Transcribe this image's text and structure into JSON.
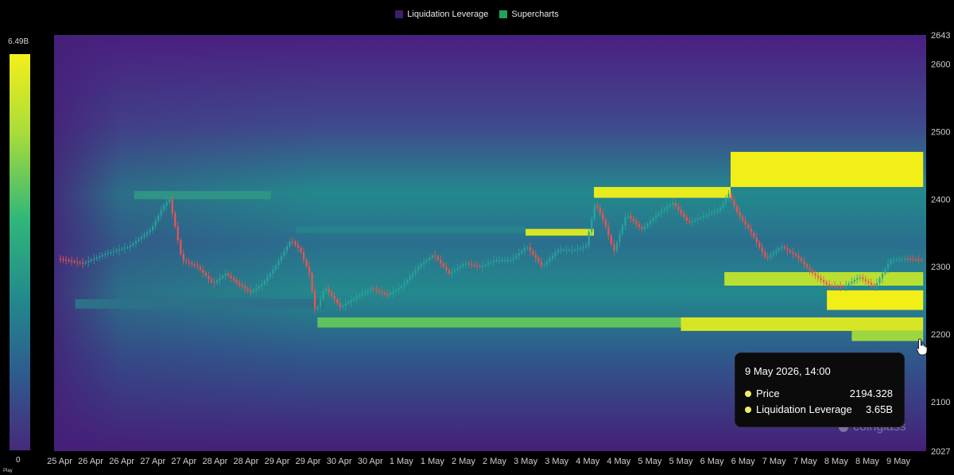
{
  "legend": [
    {
      "label": "Liquidation Leverage",
      "color": "#3f1c6e"
    },
    {
      "label": "Supercharts",
      "color": "#1fa35c"
    }
  ],
  "colorbar": {
    "max_label": "6.49B",
    "min_label": "0"
  },
  "play_label": "Play",
  "tooltip": {
    "title": "9 May 2026, 14:00",
    "rows": [
      {
        "label": "Price",
        "value": "2194.328"
      },
      {
        "label": "Liquidation Leverage",
        "value": "3.65B"
      }
    ]
  },
  "watermark": "coinglass",
  "colors": {
    "background": "#000000",
    "heat_low": "#4a1c7a",
    "heat_mid": "#23898d",
    "heat_high": "#f2ee18",
    "candle_up": "#26a69a",
    "candle_down": "#ef5350"
  },
  "chart_data": {
    "type": "heatmap",
    "title": "",
    "xlabel": "",
    "ylabel": "",
    "x_ticks": [
      "25 Apr",
      "26 Apr",
      "26 Apr",
      "27 Apr",
      "27 Apr",
      "28 Apr",
      "28 Apr",
      "29 Apr",
      "29 Apr",
      "30 Apr",
      "30 Apr",
      "1 May",
      "1 May",
      "2 May",
      "2 May",
      "3 May",
      "3 May",
      "4 May",
      "4 May",
      "5 May",
      "5 May",
      "6 May",
      "6 May",
      "7 May",
      "7 May",
      "8 May",
      "8 May",
      "9 May"
    ],
    "y_ticks": [
      2027,
      2100,
      2200,
      2300,
      2400,
      2500,
      2600,
      2643
    ],
    "ylim": [
      2027,
      2643
    ],
    "legend_position": "top-center",
    "grid": false,
    "colorbar_range": [
      0,
      6.49
    ],
    "colorbar_unit": "B",
    "liquidation_bands": [
      {
        "price_low": 2400,
        "price_high": 2412,
        "start_index": 2.4,
        "end_index": 6.8,
        "intensity": 0.5
      },
      {
        "price_low": 2350,
        "price_high": 2360,
        "start_index": 7.6,
        "end_index": 15.0,
        "intensity": 0.42
      },
      {
        "price_low": 2238,
        "price_high": 2252,
        "start_index": 0.5,
        "end_index": 8.5,
        "intensity": 0.35
      },
      {
        "price_low": 2346,
        "price_high": 2356,
        "start_index": 15.0,
        "end_index": 17.2,
        "intensity": 0.95
      },
      {
        "price_low": 2402,
        "price_high": 2418,
        "start_index": 17.2,
        "end_index": 21.6,
        "intensity": 0.98
      },
      {
        "price_low": 2418,
        "price_high": 2470,
        "start_index": 21.6,
        "end_index": 27.8,
        "intensity": 1.0
      },
      {
        "price_low": 2210,
        "price_high": 2225,
        "start_index": 8.3,
        "end_index": 20.0,
        "intensity": 0.72
      },
      {
        "price_low": 2205,
        "price_high": 2225,
        "start_index": 20.0,
        "end_index": 27.8,
        "intensity": 0.95
      },
      {
        "price_low": 2272,
        "price_high": 2292,
        "start_index": 21.4,
        "end_index": 27.8,
        "intensity": 0.9
      },
      {
        "price_low": 2236,
        "price_high": 2265,
        "start_index": 24.7,
        "end_index": 27.8,
        "intensity": 1.0
      },
      {
        "price_low": 2190,
        "price_high": 2205,
        "start_index": 25.5,
        "end_index": 27.8,
        "intensity": 0.85
      }
    ],
    "price_series": {
      "name": "Price",
      "x_index": [
        0,
        0.8,
        1.6,
        2.3,
        3.0,
        3.4,
        3.6,
        4.0,
        4.5,
        5.0,
        5.4,
        5.8,
        6.2,
        6.6,
        7.0,
        7.5,
        7.8,
        8.1,
        8.3,
        8.6,
        9.1,
        9.6,
        10.1,
        10.6,
        11.1,
        11.6,
        12.1,
        12.6,
        13.1,
        13.6,
        14.1,
        14.6,
        15.1,
        15.6,
        16.1,
        16.6,
        17.0,
        17.3,
        17.6,
        17.9,
        18.3,
        18.8,
        19.3,
        19.8,
        20.3,
        20.8,
        21.3,
        21.6,
        21.9,
        22.3,
        22.8,
        23.3,
        23.8,
        24.3,
        24.8,
        25.3,
        25.8,
        26.3,
        26.8,
        27.3,
        27.8
      ],
      "values": [
        2312,
        2305,
        2320,
        2330,
        2355,
        2390,
        2400,
        2310,
        2300,
        2275,
        2290,
        2275,
        2262,
        2275,
        2300,
        2340,
        2325,
        2290,
        2232,
        2270,
        2240,
        2255,
        2268,
        2258,
        2272,
        2300,
        2318,
        2290,
        2305,
        2300,
        2310,
        2310,
        2330,
        2300,
        2325,
        2325,
        2330,
        2395,
        2365,
        2322,
        2378,
        2355,
        2378,
        2395,
        2365,
        2375,
        2385,
        2408,
        2378,
        2352,
        2312,
        2330,
        2315,
        2290,
        2272,
        2270,
        2285,
        2270,
        2310,
        2312,
        2310
      ]
    }
  }
}
